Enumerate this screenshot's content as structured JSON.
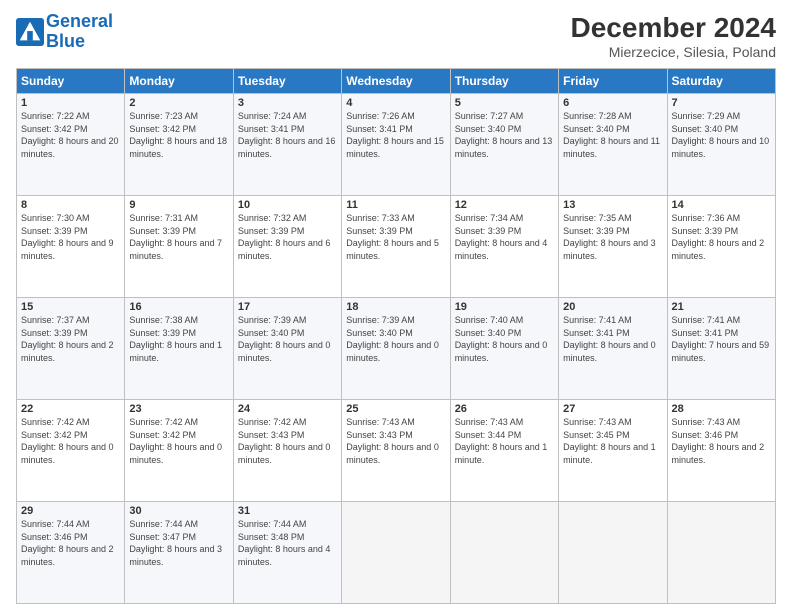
{
  "logo": {
    "line1": "General",
    "line2": "Blue"
  },
  "title": "December 2024",
  "subtitle": "Mierzecice, Silesia, Poland",
  "days_of_week": [
    "Sunday",
    "Monday",
    "Tuesday",
    "Wednesday",
    "Thursday",
    "Friday",
    "Saturday"
  ],
  "weeks": [
    [
      {
        "day": "1",
        "sunrise": "7:22 AM",
        "sunset": "3:42 PM",
        "daylight": "8 hours and 20 minutes."
      },
      {
        "day": "2",
        "sunrise": "7:23 AM",
        "sunset": "3:42 PM",
        "daylight": "8 hours and 18 minutes."
      },
      {
        "day": "3",
        "sunrise": "7:24 AM",
        "sunset": "3:41 PM",
        "daylight": "8 hours and 16 minutes."
      },
      {
        "day": "4",
        "sunrise": "7:26 AM",
        "sunset": "3:41 PM",
        "daylight": "8 hours and 15 minutes."
      },
      {
        "day": "5",
        "sunrise": "7:27 AM",
        "sunset": "3:40 PM",
        "daylight": "8 hours and 13 minutes."
      },
      {
        "day": "6",
        "sunrise": "7:28 AM",
        "sunset": "3:40 PM",
        "daylight": "8 hours and 11 minutes."
      },
      {
        "day": "7",
        "sunrise": "7:29 AM",
        "sunset": "3:40 PM",
        "daylight": "8 hours and 10 minutes."
      }
    ],
    [
      {
        "day": "8",
        "sunrise": "7:30 AM",
        "sunset": "3:39 PM",
        "daylight": "8 hours and 9 minutes."
      },
      {
        "day": "9",
        "sunrise": "7:31 AM",
        "sunset": "3:39 PM",
        "daylight": "8 hours and 7 minutes."
      },
      {
        "day": "10",
        "sunrise": "7:32 AM",
        "sunset": "3:39 PM",
        "daylight": "8 hours and 6 minutes."
      },
      {
        "day": "11",
        "sunrise": "7:33 AM",
        "sunset": "3:39 PM",
        "daylight": "8 hours and 5 minutes."
      },
      {
        "day": "12",
        "sunrise": "7:34 AM",
        "sunset": "3:39 PM",
        "daylight": "8 hours and 4 minutes."
      },
      {
        "day": "13",
        "sunrise": "7:35 AM",
        "sunset": "3:39 PM",
        "daylight": "8 hours and 3 minutes."
      },
      {
        "day": "14",
        "sunrise": "7:36 AM",
        "sunset": "3:39 PM",
        "daylight": "8 hours and 2 minutes."
      }
    ],
    [
      {
        "day": "15",
        "sunrise": "7:37 AM",
        "sunset": "3:39 PM",
        "daylight": "8 hours and 2 minutes."
      },
      {
        "day": "16",
        "sunrise": "7:38 AM",
        "sunset": "3:39 PM",
        "daylight": "8 hours and 1 minute."
      },
      {
        "day": "17",
        "sunrise": "7:39 AM",
        "sunset": "3:40 PM",
        "daylight": "8 hours and 0 minutes."
      },
      {
        "day": "18",
        "sunrise": "7:39 AM",
        "sunset": "3:40 PM",
        "daylight": "8 hours and 0 minutes."
      },
      {
        "day": "19",
        "sunrise": "7:40 AM",
        "sunset": "3:40 PM",
        "daylight": "8 hours and 0 minutes."
      },
      {
        "day": "20",
        "sunrise": "7:41 AM",
        "sunset": "3:41 PM",
        "daylight": "8 hours and 0 minutes."
      },
      {
        "day": "21",
        "sunrise": "7:41 AM",
        "sunset": "3:41 PM",
        "daylight": "7 hours and 59 minutes."
      }
    ],
    [
      {
        "day": "22",
        "sunrise": "7:42 AM",
        "sunset": "3:42 PM",
        "daylight": "8 hours and 0 minutes."
      },
      {
        "day": "23",
        "sunrise": "7:42 AM",
        "sunset": "3:42 PM",
        "daylight": "8 hours and 0 minutes."
      },
      {
        "day": "24",
        "sunrise": "7:42 AM",
        "sunset": "3:43 PM",
        "daylight": "8 hours and 0 minutes."
      },
      {
        "day": "25",
        "sunrise": "7:43 AM",
        "sunset": "3:43 PM",
        "daylight": "8 hours and 0 minutes."
      },
      {
        "day": "26",
        "sunrise": "7:43 AM",
        "sunset": "3:44 PM",
        "daylight": "8 hours and 1 minute."
      },
      {
        "day": "27",
        "sunrise": "7:43 AM",
        "sunset": "3:45 PM",
        "daylight": "8 hours and 1 minute."
      },
      {
        "day": "28",
        "sunrise": "7:43 AM",
        "sunset": "3:46 PM",
        "daylight": "8 hours and 2 minutes."
      }
    ],
    [
      {
        "day": "29",
        "sunrise": "7:44 AM",
        "sunset": "3:46 PM",
        "daylight": "8 hours and 2 minutes."
      },
      {
        "day": "30",
        "sunrise": "7:44 AM",
        "sunset": "3:47 PM",
        "daylight": "8 hours and 3 minutes."
      },
      {
        "day": "31",
        "sunrise": "7:44 AM",
        "sunset": "3:48 PM",
        "daylight": "8 hours and 4 minutes."
      },
      null,
      null,
      null,
      null
    ]
  ],
  "labels": {
    "sunrise": "Sunrise:",
    "sunset": "Sunset:",
    "daylight": "Daylight:"
  }
}
